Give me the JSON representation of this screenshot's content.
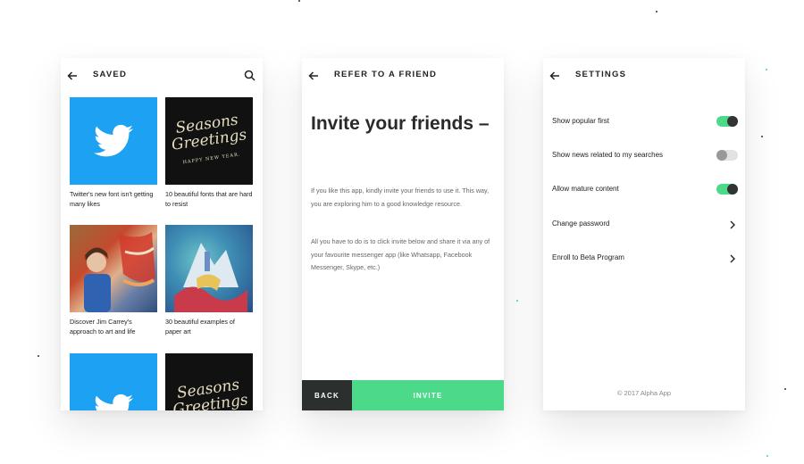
{
  "colors": {
    "accent": "#4cd98a",
    "dark": "#2b2f2e",
    "twitter": "#1da1f2"
  },
  "saved": {
    "title": "SAVED",
    "back_icon": "arrow-left-icon",
    "search_icon": "search-icon",
    "items": [
      {
        "caption": "Twitter's new font isn't getting many likes",
        "image": "twitter-logo"
      },
      {
        "caption": "10 beautiful fonts that are hard to resist",
        "image": "seasons-greetings-lettering"
      },
      {
        "caption": "Discover Jim Carrey's approach to art and life",
        "image": "artist-painting-photo"
      },
      {
        "caption": "30 beautiful examples of paper art",
        "image": "paper-art-photo"
      },
      {
        "caption": "",
        "image": "twitter-logo"
      },
      {
        "caption": "",
        "image": "seasons-greetings-lettering"
      }
    ],
    "lettering": {
      "line1": "Seasons",
      "line2": "Greetings",
      "line3": "HAPPY NEW YEAR."
    }
  },
  "refer": {
    "title": "REFER TO A FRIEND",
    "heading": "Invite your friends –",
    "para1": "If you like this app, kindly invite your friends to use it. This way, you are exploring him to a good knowledge resource.",
    "para2": "All you have to do is to click invite below and share it via any of your favourite messenger app (like Whatsapp, Facebook Messenger, Skype, etc.)",
    "back_label": "BACK",
    "invite_label": "INVITE"
  },
  "settings": {
    "title": "SETTINGS",
    "rows": [
      {
        "label": "Show popular first",
        "control": "toggle",
        "on": true
      },
      {
        "label": "Show news related to my searches",
        "control": "toggle",
        "on": false
      },
      {
        "label": "Allow mature content",
        "control": "toggle",
        "on": true
      },
      {
        "label": "Change password",
        "control": "chevron-right-icon"
      },
      {
        "label": "Enroll to Beta Program",
        "control": "chevron-right-icon"
      }
    ],
    "footer": "© 2017 Alpha App"
  }
}
